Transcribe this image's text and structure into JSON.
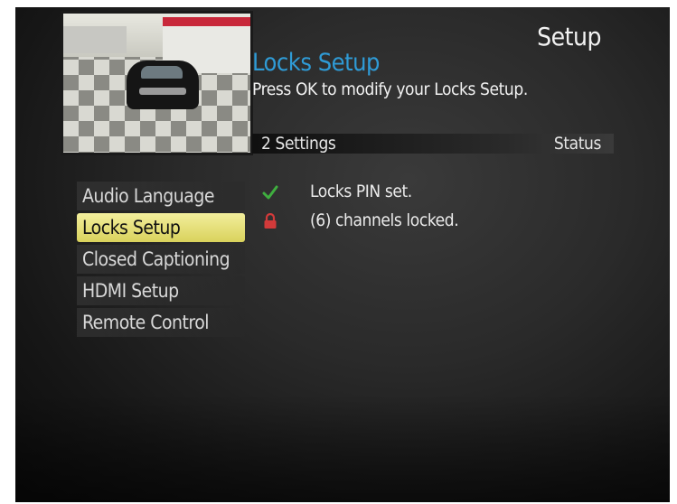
{
  "header": {
    "title": "Setup"
  },
  "section": {
    "title": "Locks Setup",
    "instruction": "Press OK to modify your Locks Setup."
  },
  "settings_bar": {
    "count_label": "2 Settings",
    "status_label": "Status"
  },
  "menu": {
    "items": [
      {
        "label": "Audio Language"
      },
      {
        "label": "Locks Setup",
        "selected": true
      },
      {
        "label": "Closed Captioning"
      },
      {
        "label": "HDMI Setup"
      },
      {
        "label": "Remote Control"
      }
    ]
  },
  "status": {
    "items": [
      {
        "icon": "checkmark-icon",
        "text": "Locks PIN set.",
        "color": "#3fae3f"
      },
      {
        "icon": "lock-icon",
        "text": "(6) channels locked.",
        "color": "#d23a3a"
      }
    ]
  },
  "colors": {
    "accent": "#2f9bd6",
    "selection": "#e8e27a"
  }
}
